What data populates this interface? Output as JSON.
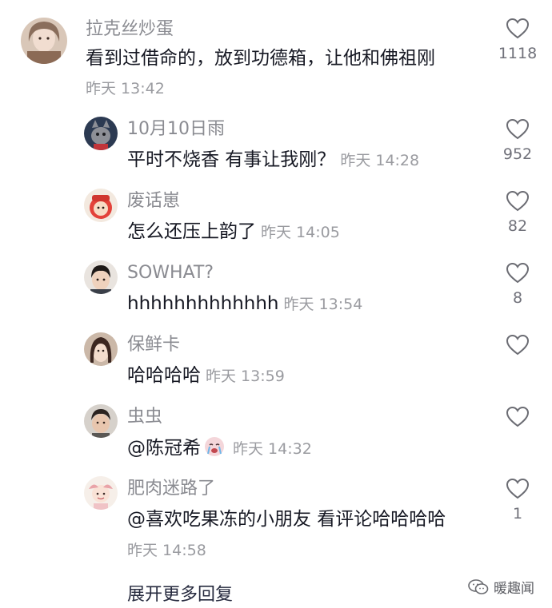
{
  "comments": [
    {
      "user": "拉克丝炒蛋",
      "text": "看到过借命的，放到功德箱，让他和佛祖刚",
      "time": "昨天 13:42",
      "likes": "1118"
    },
    {
      "user": "10月10日雨",
      "text": "平时不烧香 有事让我刚？",
      "time": "昨天 14:28",
      "likes": "952"
    },
    {
      "user": "废话崽",
      "text": "怎么还压上韵了",
      "time": "昨天 14:05",
      "likes": "82"
    },
    {
      "user": "SOWHAT?",
      "text": "hhhhhhhhhhhhh",
      "time": "昨天 13:54",
      "likes": "8"
    },
    {
      "user": "保鲜卡",
      "text": "哈哈哈哈",
      "time": "昨天 13:59",
      "likes": ""
    },
    {
      "user": "虫虫",
      "text": "@陈冠希",
      "time": "昨天 14:32",
      "likes": ""
    },
    {
      "user": "肥肉迷路了",
      "text": "@喜欢吃果冻的小朋友 看评论哈哈哈哈",
      "time": "昨天 14:58",
      "likes": "1"
    }
  ],
  "expand_label": "展开更多回复",
  "watermark": "暖趣闻",
  "icons": {
    "like": "heart-outline-icon",
    "emoji": "crying-face-emoji-icon",
    "watermark_logo": "wechat-logo-icon"
  },
  "colors": {
    "name": "#8a8b91",
    "text": "#161823",
    "time": "#9a9ba0",
    "heart": "#6b6c73"
  }
}
